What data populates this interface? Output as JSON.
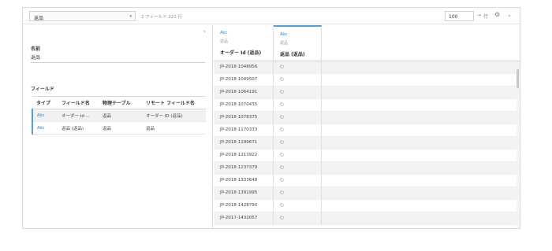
{
  "toolbar": {
    "table_select": "返品",
    "caret": "▾",
    "summary": "2 フィールド 221 行",
    "rows_value": "100",
    "rows_arrow": "→",
    "rows_label": "行",
    "settings_icon": "gear-icon",
    "menu_icon": "chevron-down-icon"
  },
  "left": {
    "collapse_glyph": "‹",
    "name_label": "名前",
    "name_value": "返品",
    "fields_label": "フィールド",
    "columns": [
      "タイプ",
      "フィールド名",
      "物理テーブル",
      "リモート フィールド名"
    ],
    "fields": [
      {
        "type": "Abc",
        "name": "オーダー Id ...",
        "table": "返品",
        "remote": "オーダー ID (返品)"
      },
      {
        "type": "Abc",
        "name": "返品 (返品)",
        "table": "返品",
        "remote": "返品"
      }
    ]
  },
  "grid": {
    "columns": [
      {
        "type": "Abc",
        "source": "返品",
        "name": "オーダー Id (返品)"
      },
      {
        "type": "Abc",
        "source": "返品",
        "name": "返品 (返品)"
      }
    ],
    "rows": [
      [
        "JP-2018-1048956",
        "○"
      ],
      [
        "JP-2018-1049507",
        "○"
      ],
      [
        "JP-2018-1064191",
        "○"
      ],
      [
        "JP-2018-1070435",
        "○"
      ],
      [
        "JP-2018-1078375",
        "○"
      ],
      [
        "JP-2018-1170333",
        "○"
      ],
      [
        "JP-2018-1199671",
        "○"
      ],
      [
        "JP-2018-1213922",
        "○"
      ],
      [
        "JP-2018-1237379",
        "○"
      ],
      [
        "JP-2018-1333648",
        "○"
      ],
      [
        "JP-2018-1391995",
        "○"
      ],
      [
        "JP-2018-1428790",
        "○"
      ],
      [
        "JP-2017-1432057",
        "○"
      ]
    ]
  },
  "colors": {
    "accent": "#5b9bd5",
    "type_text": "#3a7fc1"
  }
}
